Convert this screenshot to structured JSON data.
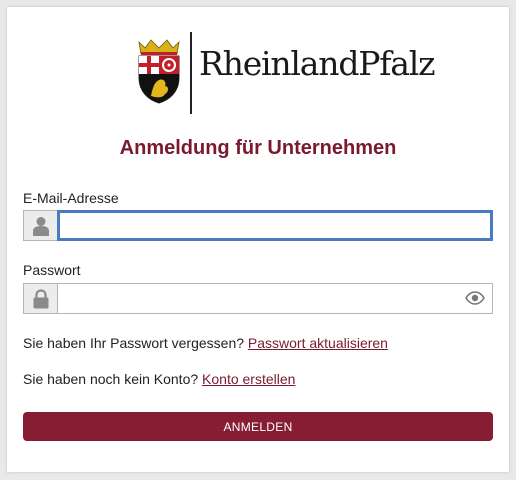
{
  "brand": {
    "wordmark": "RheinlandPfalz",
    "colors": {
      "accent": "#861d33",
      "title": "#7a1a30",
      "focus": "#4a7bc0"
    }
  },
  "page": {
    "title": "Anmeldung für Unternehmen"
  },
  "form": {
    "email": {
      "label": "E-Mail-Adresse",
      "value": "",
      "icon": "user-icon"
    },
    "password": {
      "label": "Passwort",
      "value": "",
      "icon": "lock-icon",
      "toggle_icon": "eye-icon"
    },
    "forgot": {
      "text": "Sie haben Ihr Passwort vergessen?",
      "link": "Passwort aktualisieren"
    },
    "register": {
      "text": "Sie haben noch kein Konto?",
      "link": "Konto erstellen"
    },
    "submit_label": "ANMELDEN"
  }
}
